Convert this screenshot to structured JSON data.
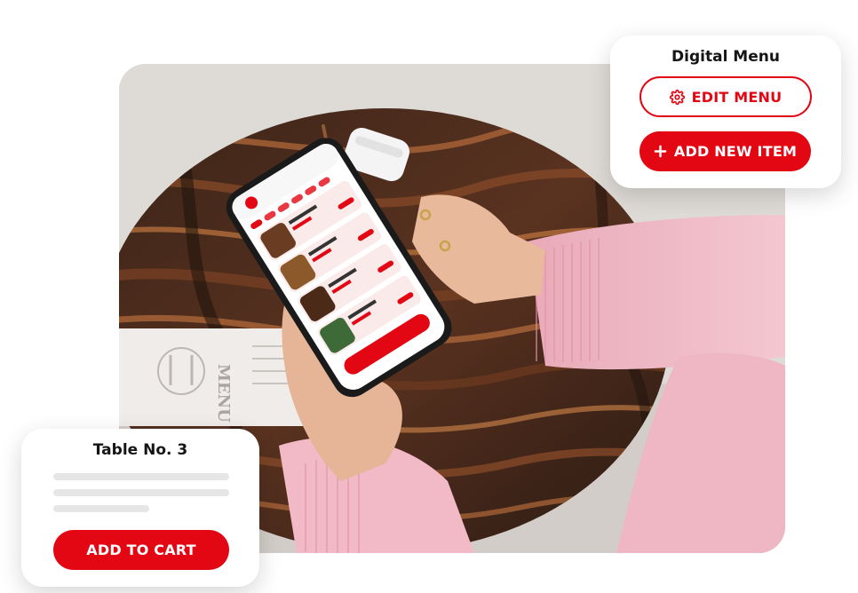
{
  "photo": {
    "menu_card_text": "MENU"
  },
  "digital_menu_card": {
    "title": "Digital Menu",
    "edit_label": "EDIT MENU",
    "edit_icon": "gear-icon",
    "add_label": "ADD NEW ITEM",
    "add_icon": "plus-icon"
  },
  "table_card": {
    "title": "Table No. 3",
    "add_to_cart_label": "ADD TO CART"
  },
  "colors": {
    "accent": "#e30613"
  }
}
